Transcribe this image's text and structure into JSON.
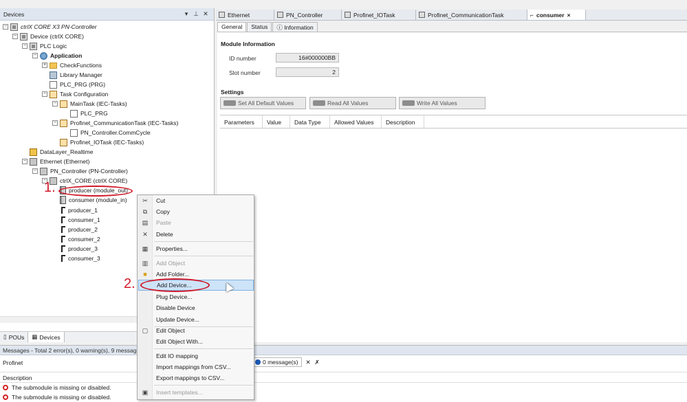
{
  "devices_panel": {
    "title": "Devices",
    "header_icons": [
      "dropdown-icon",
      "pin-icon",
      "close-icon"
    ],
    "tree": [
      {
        "label": "ctrlX CORE X3 PN-Controller",
        "italic": true
      },
      {
        "label": "Device (ctrlX CORE)"
      },
      {
        "label": "PLC Logic"
      },
      {
        "label": "Application",
        "bold": true
      },
      {
        "label": "CheckFunctions"
      },
      {
        "label": "Library Manager"
      },
      {
        "label": "PLC_PRG (PRG)"
      },
      {
        "label": "Task Configuration"
      },
      {
        "label": "MainTask (IEC-Tasks)"
      },
      {
        "label": "PLC_PRG"
      },
      {
        "label": "Profinet_CommunicationTask (IEC-Tasks)"
      },
      {
        "label": "PN_Controller.CommCycle"
      },
      {
        "label": "Profinet_IOTask (IEC-Tasks)"
      },
      {
        "label": "DataLayer_Realtime"
      },
      {
        "label": "Ethernet (Ethernet)"
      },
      {
        "label": "PN_Controller (PN-Controller)"
      },
      {
        "label": "ctrlX_CORE (ctrlX CORE)"
      },
      {
        "label": "producer (module_out)"
      },
      {
        "label": "consumer (module_in)"
      },
      {
        "label": "producer_1"
      },
      {
        "label": "consumer_1"
      },
      {
        "label": "producer_2"
      },
      {
        "label": "consumer_2"
      },
      {
        "label": "producer_3"
      },
      {
        "label": "consumer_3"
      }
    ],
    "bottom_tabs": [
      "POUs",
      "Devices"
    ]
  },
  "annotations": {
    "step1": "1.",
    "step2": "2."
  },
  "editor_tabs": [
    "Ethernet",
    "PN_Controller",
    "Profinet_IOTask",
    "Profinet_CommunicationTask",
    "consumer"
  ],
  "active_tab_close": "×",
  "sub_tabs": [
    "General",
    "Status",
    "Information"
  ],
  "module_info": {
    "title": "Module Information",
    "id_label": "ID number",
    "id_value": "16#000000BB",
    "slot_label": "Slot number",
    "slot_value": "2"
  },
  "settings": {
    "title": "Settings",
    "buttons": [
      "Set All Default Values",
      "Read All Values",
      "Write All Values"
    ]
  },
  "param_table": {
    "columns": [
      "Parameters",
      "Value",
      "Data Type",
      "Allowed Values",
      "Description"
    ]
  },
  "context_menu": {
    "items": [
      {
        "label": "Cut",
        "icon": "scissors-icon"
      },
      {
        "label": "Copy",
        "icon": "copy-icon"
      },
      {
        "label": "Paste",
        "icon": "paste-icon",
        "disabled": true
      },
      {
        "label": "Delete",
        "icon": "delete-x-icon"
      },
      {
        "label": "Properties...",
        "icon": "properties-icon"
      },
      {
        "label": "Add Object",
        "icon": "add-object-icon",
        "disabled": true
      },
      {
        "label": "Add Folder...",
        "icon": "folder-icon"
      },
      {
        "label": "Add Device...",
        "highlighted": true
      },
      {
        "label": "Plug Device..."
      },
      {
        "label": "Disable Device"
      },
      {
        "label": "Update Device..."
      },
      {
        "label": "Edit Object",
        "icon": "edit-object-icon"
      },
      {
        "label": "Edit Object With..."
      },
      {
        "label": "Edit IO mapping"
      },
      {
        "label": "Import mappings from CSV..."
      },
      {
        "label": "Export mappings to CSV..."
      },
      {
        "label": "Insert templates...",
        "icon": "template-icon",
        "disabled": true
      }
    ]
  },
  "messages": {
    "header": "Messages - Total 2 error(s), 0 warning(s), 9 message(s)",
    "filter": "Profinet",
    "info_button": "0 message(s)",
    "desc_header": "Description",
    "errors": [
      "The submodule is missing or disabled.",
      "The submodule is missing or disabled."
    ]
  },
  "colors": {
    "accent": "#d11a2a",
    "highlight": "#cde3f8",
    "header": "#dfe6ef"
  }
}
